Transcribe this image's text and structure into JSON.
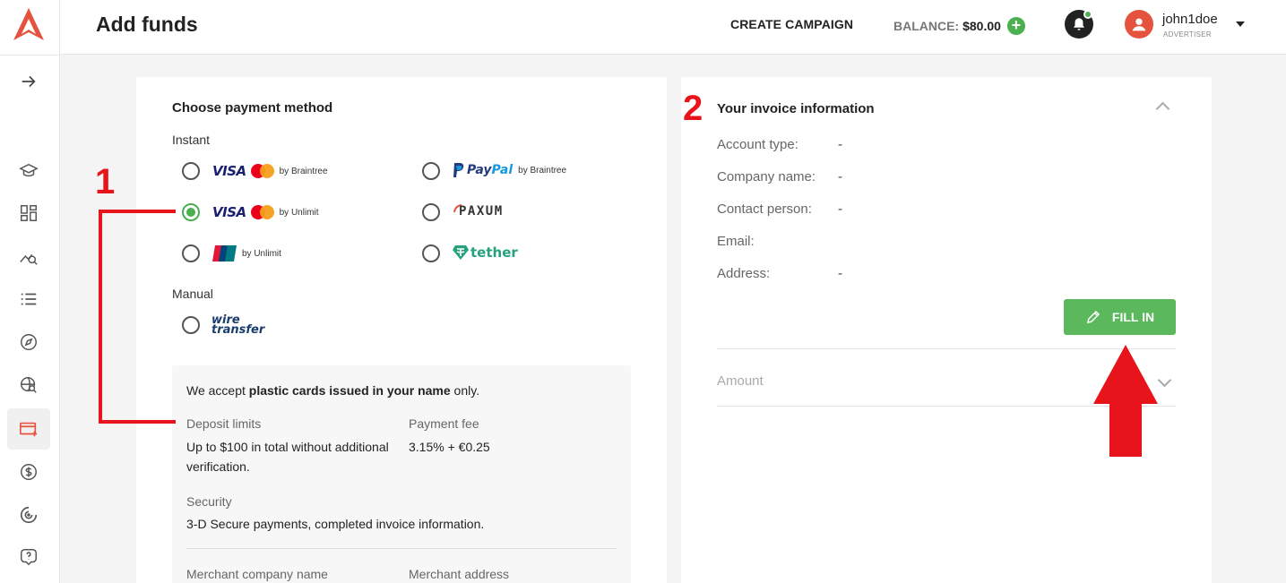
{
  "header": {
    "title": "Add funds",
    "create_campaign": "CREATE CAMPAIGN",
    "balance_label": "BALANCE:",
    "balance_value": "$80.00",
    "username": "john1doe",
    "role": "ADVERTISER"
  },
  "sidebar": {
    "items": [
      "expand-arrow",
      "academy",
      "dashboard",
      "analytics",
      "campaigns-list",
      "explore",
      "search-traffic",
      "add-funds",
      "billing",
      "targeting",
      "help"
    ],
    "active": "add-funds"
  },
  "payment": {
    "title": "Choose payment method",
    "instant_label": "Instant",
    "manual_label": "Manual",
    "methods": [
      {
        "logo": "VISA",
        "provider": "by Braintree",
        "selected": false
      },
      {
        "logo": "VISA",
        "provider": "by Unlimit",
        "selected": true
      },
      {
        "logo": "UnionPay",
        "provider": "by Unlimit",
        "selected": false
      },
      {
        "logo": "PayPal",
        "logo_part1": "Pay",
        "logo_part2": "Pal",
        "provider": "by Braintree",
        "selected": false
      },
      {
        "logo": "PAXUM",
        "selected": false
      },
      {
        "logo": "tether",
        "selected": false
      },
      {
        "logo": "wire transfer",
        "logo_line1": "wire",
        "logo_line2": "transfer",
        "selected": false
      }
    ]
  },
  "info_box": {
    "notice_prefix": "We accept ",
    "notice_bold": "plastic cards issued in your name",
    "notice_suffix": " only.",
    "deposit_limits_label": "Deposit limits",
    "deposit_limits_value": "Up to $100 in total without additional verification.",
    "payment_fee_label": "Payment fee",
    "payment_fee_value": "3.15% + €0.25",
    "security_label": "Security",
    "security_value": "3-D Secure payments, completed invoice information.",
    "merchant_company_label": "Merchant company name",
    "merchant_address_label": "Merchant address"
  },
  "invoice": {
    "title": "Your invoice information",
    "fields": [
      {
        "label": "Account type:",
        "value": "-"
      },
      {
        "label": "Company name:",
        "value": "-"
      },
      {
        "label": "Contact person:",
        "value": "-"
      },
      {
        "label": "Email:",
        "value": ""
      },
      {
        "label": "Address:",
        "value": "-"
      }
    ],
    "fill_in": "FILL IN",
    "amount_label": "Amount"
  },
  "annotations": {
    "step1": "1",
    "step2": "2",
    "color": "#e8141c"
  },
  "colors": {
    "brand": "#e5533f",
    "accent_green": "#5cb85c",
    "radio_selected": "#4caf50"
  }
}
